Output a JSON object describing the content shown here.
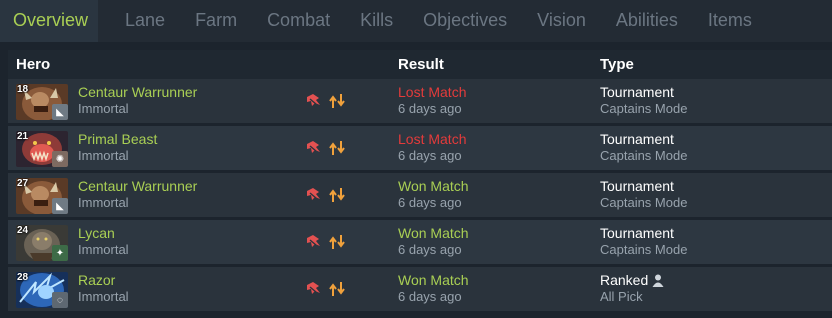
{
  "tabs": [
    "Overview",
    "Lane",
    "Farm",
    "Combat",
    "Kills",
    "Objectives",
    "Vision",
    "Abilities",
    "Items"
  ],
  "headers": {
    "hero": "Hero",
    "result": "Result",
    "type": "Type"
  },
  "rows": [
    {
      "level": "18",
      "hero": "Centaur Warrunner",
      "rank": "Immortal",
      "result": "Lost Match",
      "outcome": "lost",
      "ago": "6 days ago",
      "type": "Tournament",
      "mode": "Captains Mode",
      "facet_color": "#6f7a84",
      "portrait": "centaur"
    },
    {
      "level": "21",
      "hero": "Primal Beast",
      "rank": "Immortal",
      "result": "Lost Match",
      "outcome": "lost",
      "ago": "6 days ago",
      "type": "Tournament",
      "mode": "Captains Mode",
      "facet_color": "#7d6a61",
      "portrait": "primal"
    },
    {
      "level": "27",
      "hero": "Centaur Warrunner",
      "rank": "Immortal",
      "result": "Won Match",
      "outcome": "won",
      "ago": "6 days ago",
      "type": "Tournament",
      "mode": "Captains Mode",
      "facet_color": "#6f7a84",
      "portrait": "centaur"
    },
    {
      "level": "24",
      "hero": "Lycan",
      "rank": "Immortal",
      "result": "Won Match",
      "outcome": "won",
      "ago": "6 days ago",
      "type": "Tournament",
      "mode": "Captains Mode",
      "facet_color": "#3d6b47",
      "portrait": "lycan"
    },
    {
      "level": "28",
      "hero": "Razor",
      "rank": "Immortal",
      "result": "Won Match",
      "outcome": "won",
      "ago": "6 days ago",
      "type": "Ranked",
      "mode": "All Pick",
      "facet_color": "#5e6872",
      "portrait": "razor",
      "ranked_icon": "person-icon"
    }
  ]
}
